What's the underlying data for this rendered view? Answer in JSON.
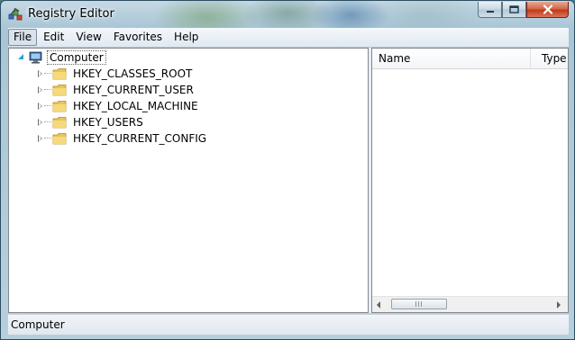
{
  "window": {
    "title": "Registry Editor"
  },
  "menu": [
    "File",
    "Edit",
    "View",
    "Favorites",
    "Help"
  ],
  "tree": {
    "root": "Computer",
    "children": [
      "HKEY_CLASSES_ROOT",
      "HKEY_CURRENT_USER",
      "HKEY_LOCAL_MACHINE",
      "HKEY_USERS",
      "HKEY_CURRENT_CONFIG"
    ]
  },
  "list": {
    "columns": [
      "Name",
      "Type"
    ]
  },
  "status": {
    "text": "Computer"
  },
  "icons": {
    "app": "registry-editor-icon",
    "root": "computer-icon",
    "key": "folder-icon"
  },
  "colors": {
    "close_button": "#c3391a",
    "tree_expander": "#26a0da",
    "folder": "#e8c45a"
  }
}
